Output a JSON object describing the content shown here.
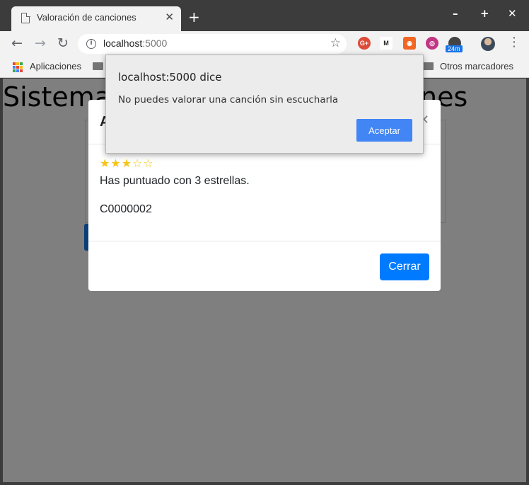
{
  "browser": {
    "tab_title": "Valoración de canciones",
    "url_host": "localhost",
    "url_port": ":5000",
    "extension_badge": "24m",
    "bookmarks": {
      "apps_label": "Aplicaciones",
      "other_label": "Otros marcadores"
    }
  },
  "page": {
    "heading_left": "Sistema",
    "heading_right": "nes"
  },
  "modal": {
    "title": "A",
    "rating_stars": 3,
    "rating_max": 5,
    "stars_display": "★★★☆☆",
    "rating_text": "Has puntuado con 3 estrellas.",
    "song_code": "C0000002",
    "close_button": "Cerrar"
  },
  "alert": {
    "title": "localhost:5000 dice",
    "message": "No puedes valorar una canción sin escucharla",
    "accept_button": "Aceptar"
  },
  "colors": {
    "primary_button": "#007bff",
    "alert_button": "#4285f4",
    "star": "#f5c518",
    "overlay": "#7f7f7f"
  }
}
